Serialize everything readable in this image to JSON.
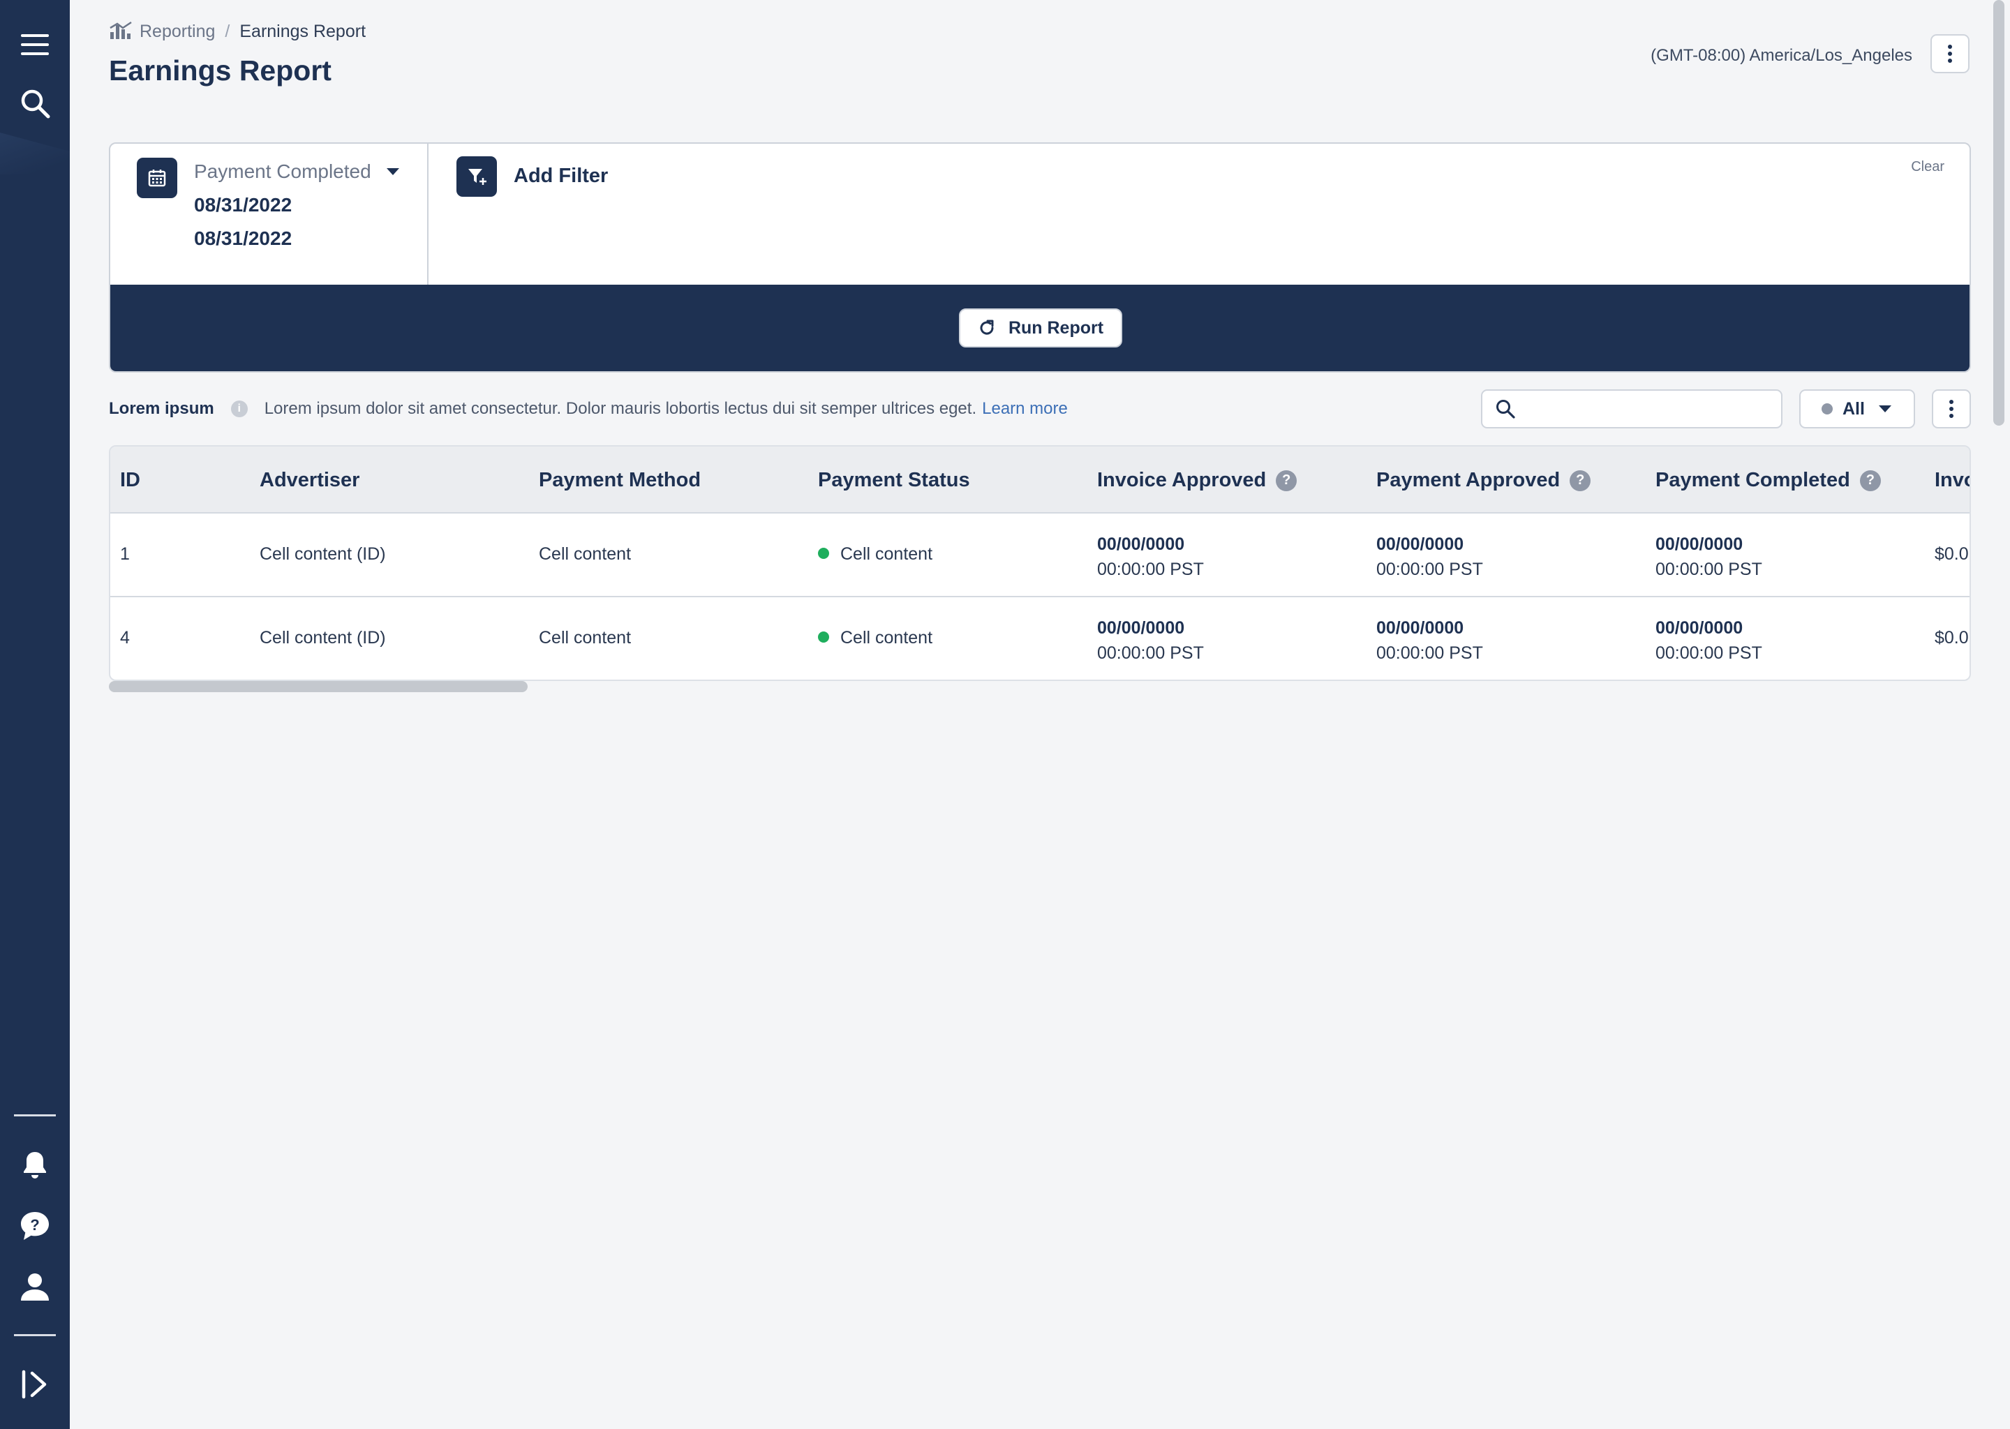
{
  "nav": {
    "menu_icon": "menu-icon",
    "search_icon": "search-icon",
    "notifications_icon": "bell-icon",
    "help_icon": "help-chat-icon",
    "profile_icon": "user-icon",
    "expand_icon": "expand-sidebar-icon"
  },
  "header": {
    "breadcrumb": {
      "parent": "Reporting",
      "separator": "/",
      "current": "Earnings Report"
    },
    "title": "Earnings Report",
    "timezone": "(GMT-08:00) America/Los_Angeles"
  },
  "filters": {
    "date_field": "Payment Completed",
    "date_start": "08/31/2022",
    "date_end": "08/31/2022",
    "add_filter_label": "Add Filter",
    "clear_label": "Clear",
    "run_report_label": "Run Report"
  },
  "info": {
    "title": "Lorem ipsum",
    "info_glyph": "i",
    "text": "Lorem ipsum dolor sit amet consectetur. Dolor mauris lobortis lectus dui sit semper ultrices eget.",
    "learn_more": "Learn more"
  },
  "toolbar": {
    "search_placeholder": "",
    "status_filter": "All"
  },
  "table": {
    "help_glyph": "?",
    "columns": [
      "ID",
      "Advertiser",
      "Payment Method",
      "Payment Status",
      "Invoice Approved",
      "Payment Approved",
      "Payment Completed",
      "Invo"
    ],
    "rows": [
      {
        "id": "1",
        "advertiser": "Cell content (ID)",
        "payment_method": "Cell content",
        "payment_status": "Cell content",
        "invoice_approved": {
          "date": "00/00/0000",
          "time": "00:00:00 PST"
        },
        "payment_approved": {
          "date": "00/00/0000",
          "time": "00:00:00 PST"
        },
        "payment_completed": {
          "date": "00/00/0000",
          "time": "00:00:00 PST"
        },
        "invoice_amount": "$0.0"
      },
      {
        "id": "4",
        "advertiser": "Cell content (ID)",
        "payment_method": "Cell content",
        "payment_status": "Cell content",
        "invoice_approved": {
          "date": "00/00/0000",
          "time": "00:00:00 PST"
        },
        "payment_approved": {
          "date": "00/00/0000",
          "time": "00:00:00 PST"
        },
        "payment_completed": {
          "date": "00/00/0000",
          "time": "00:00:00 PST"
        },
        "invoice_amount": "$0.0"
      }
    ]
  },
  "colors": {
    "navy": "#1e3152",
    "status_green": "#1fae5d",
    "link_blue": "#3c6fb6",
    "page_bg": "#f4f5f7"
  }
}
